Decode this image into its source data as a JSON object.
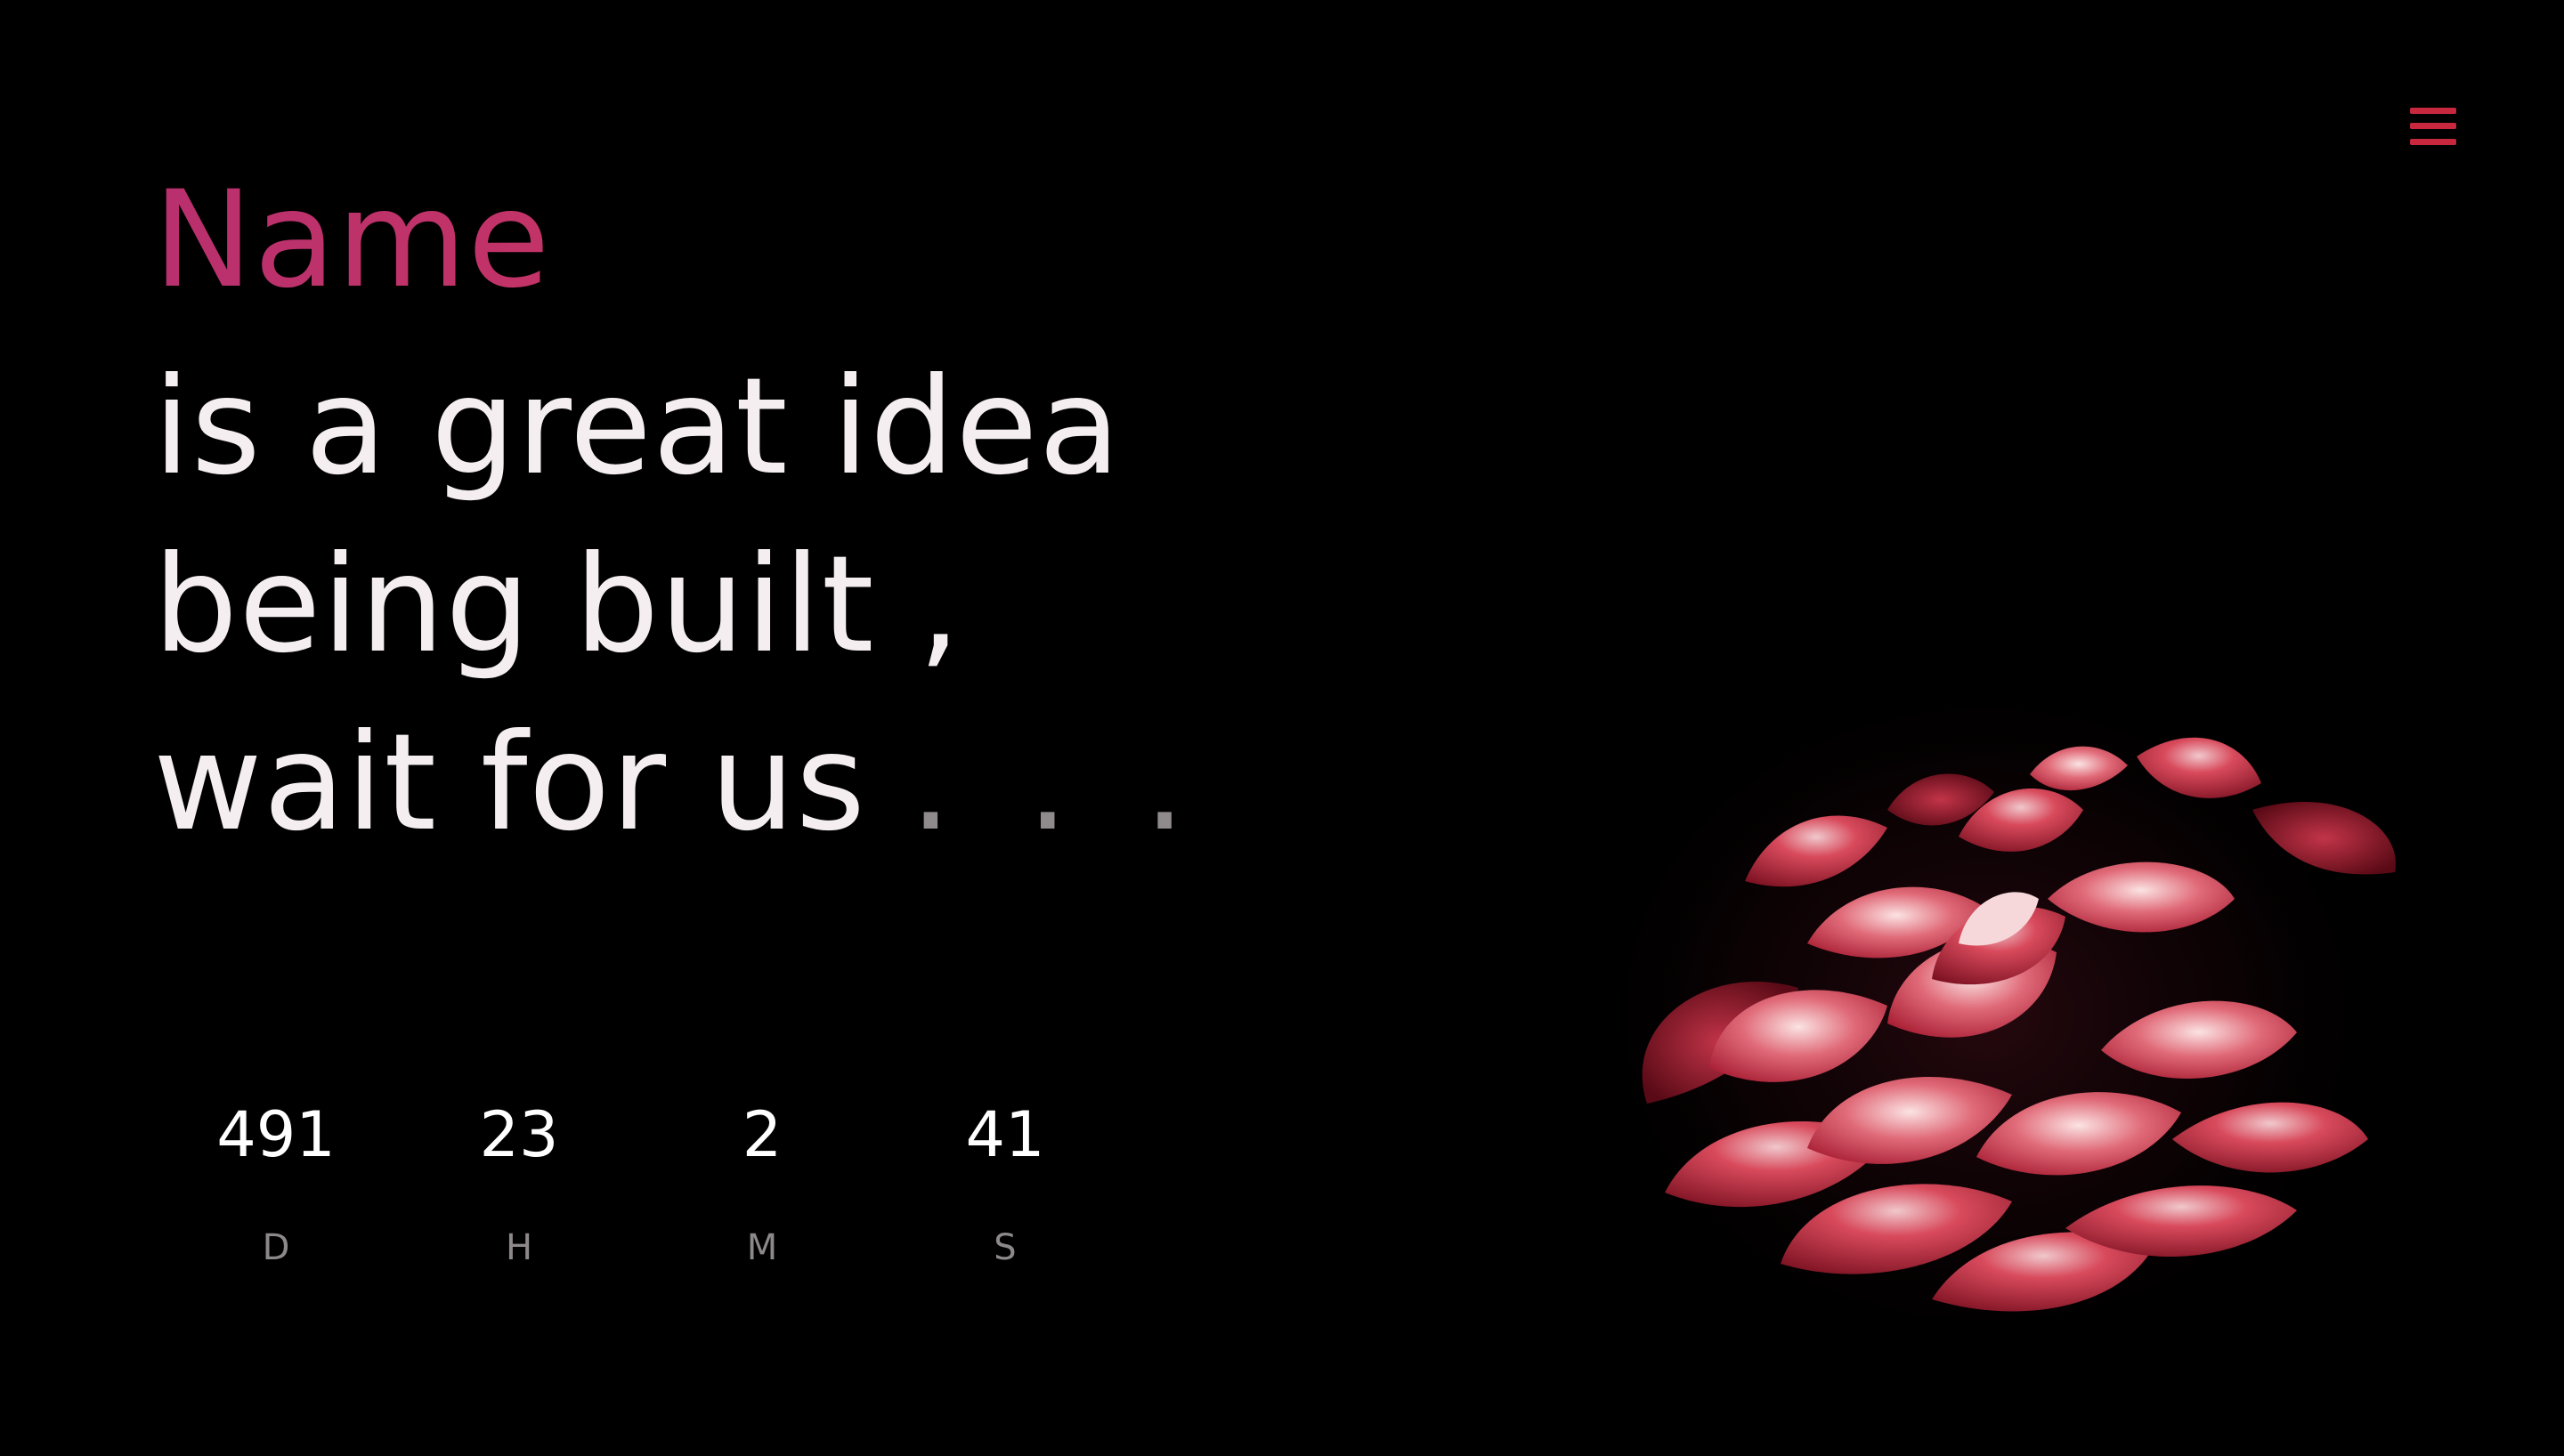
{
  "header": {
    "menu_icon": "hamburger-menu-icon",
    "menu_color": "#c8283e"
  },
  "headline": {
    "brand": "Name",
    "line1": "is a great idea",
    "line2": "being built ,",
    "line3": "wait for us",
    "ellipsis": ". . .",
    "brand_color": "#c8306a",
    "text_color": "#f4eef0"
  },
  "countdown": {
    "days": {
      "value": "491",
      "label": "D"
    },
    "hours": {
      "value": "23",
      "label": "H"
    },
    "minutes": {
      "value": "2",
      "label": "M"
    },
    "seconds": {
      "value": "41",
      "label": "S"
    }
  },
  "hero_image": {
    "subject": "red-flower-photo",
    "accent": "#c2304a"
  }
}
